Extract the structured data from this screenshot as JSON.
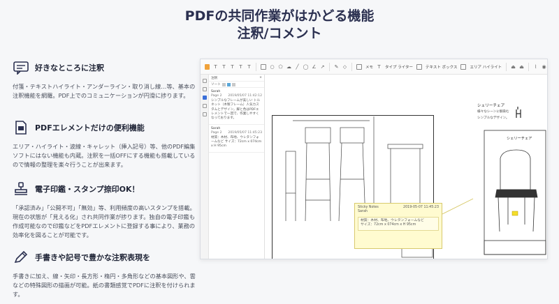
{
  "header": {
    "line1": "PDFの共同作業がはかどる機能",
    "line2": "注釈/コメント"
  },
  "features": [
    {
      "icon": "comment-bubble-icon",
      "title": "好きなところに注釈",
      "desc": "付箋・テキストハイライト・アンダーライン・取り消し線…等、基本の注釈機能を網羅。PDF上でのコミュニケーションが円滑に捗ります。"
    },
    {
      "icon": "document-stamp-icon",
      "title": "PDFエレメントだけの便利機能",
      "desc": "エリア・ハイライト・波線・キャレット（挿入記号）等、他のPDF編集ソフトにはない機能も内蔵。注釈を一括OFFにする機能も搭載しているので情報の整理を楽々行うことが出来ます。"
    },
    {
      "icon": "stamp-icon",
      "title": "電子印鑑・スタンプ捺印OK！",
      "desc": "「承認済み」「公開不可」「無効」等、利用頻度の高いスタンプを搭載。現在の状態が「見える化」され共同作業が捗ります。独自の電子印鑑も作成可能なので印鑑などをPDFエレメントに登録する事により、業務の効率化を図ることが可能です。"
    },
    {
      "icon": "pencil-icon",
      "title": "手書きや記号で豊かな注釈表現を",
      "desc": "手書きに加え、線・矢印・長方形・楕円・多角形などの基本図形や、雲などの特殊図形の描画が可能。紙の書類感覚でPDFに注釈を付けられます。"
    }
  ],
  "app": {
    "toolbar": {
      "memo": "メモ",
      "typewriter": "タイプ ライター",
      "textbox": "テキスト ボックス",
      "area_highlight": "エリア ハイライト"
    },
    "panel": {
      "title": "注釈",
      "filter": "ソート",
      "comments": [
        {
          "author": "Sarah",
          "page": "Page 2",
          "time": "2019/05/07 11:42:12",
          "text": "シンプルなフレームが美しい トルネット（木製フレーム）人気カスタムとデザイン，脚と色はPDFエレメントで一回で、作業しやすくなっております。"
        },
        {
          "author": "Sarah",
          "page": "Page 2",
          "time": "2019/05/07 11:45:23",
          "text": "材質：木材、布地、ウレタンフォームなど サイズ：72cm x 074cm x H 95cm"
        }
      ]
    },
    "note": {
      "label": "Sticky Notes",
      "time": "2019-05-07 11:45:23",
      "author": "Sarah",
      "line1": "材質：木材、布地、ウレタンフォームなど",
      "line2": "サイズ：72cm x 074cm x H 95cm"
    },
    "spec": {
      "title": "シェリーチェア",
      "sub1": "様々なシーンに馴染む",
      "sub2": "シンプルなデザイン。"
    },
    "chair_caption": "シェリーチェア"
  }
}
